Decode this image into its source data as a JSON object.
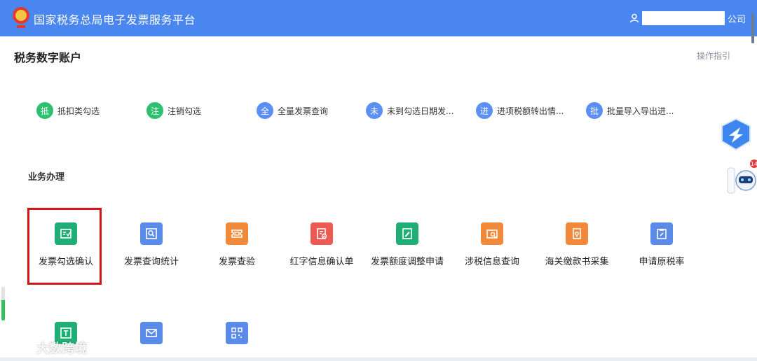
{
  "header": {
    "title": "国家税务总局电子发票服务平台",
    "company_suffix": "公司"
  },
  "page": {
    "title": "税务数字账户",
    "guide": "操作指引"
  },
  "quick_links": [
    {
      "badge": "抵",
      "label": "抵扣类勾选",
      "color": "#2fbf71"
    },
    {
      "badge": "注",
      "label": "注销勾选",
      "color": "#2fbf71"
    },
    {
      "badge": "全",
      "label": "全量发票查询",
      "color": "#5b8ff5"
    },
    {
      "badge": "未",
      "label": "未到勾选日期发...",
      "color": "#5b8ff5"
    },
    {
      "badge": "进",
      "label": "进项税额转出情...",
      "color": "#5b8ff5"
    },
    {
      "badge": "批",
      "label": "批量导入导出进...",
      "color": "#5b8ff5"
    }
  ],
  "business": {
    "title": "业务办理",
    "tiles": [
      {
        "label": "发票勾选确认",
        "icon": "invoice-check-icon"
      },
      {
        "label": "发票查询统计",
        "icon": "search-document-icon"
      },
      {
        "label": "发票查验",
        "icon": "ticket-icon"
      },
      {
        "label": "红字信息确认单",
        "icon": "red-confirm-icon"
      },
      {
        "label": "发票额度调整申请",
        "icon": "edit-document-icon"
      },
      {
        "label": "涉税信息查询",
        "icon": "search-card-icon"
      },
      {
        "label": "海关缴款书采集",
        "icon": "customs-document-icon"
      },
      {
        "label": "申请原税率",
        "icon": "clipboard-edit-icon"
      },
      {
        "label": "",
        "icon": "scan-upload-icon"
      },
      {
        "label": "",
        "icon": "mail-icon"
      },
      {
        "label": "",
        "icon": "qr-code-icon"
      }
    ]
  },
  "notification_count": "14",
  "watermark": "大数跨境"
}
